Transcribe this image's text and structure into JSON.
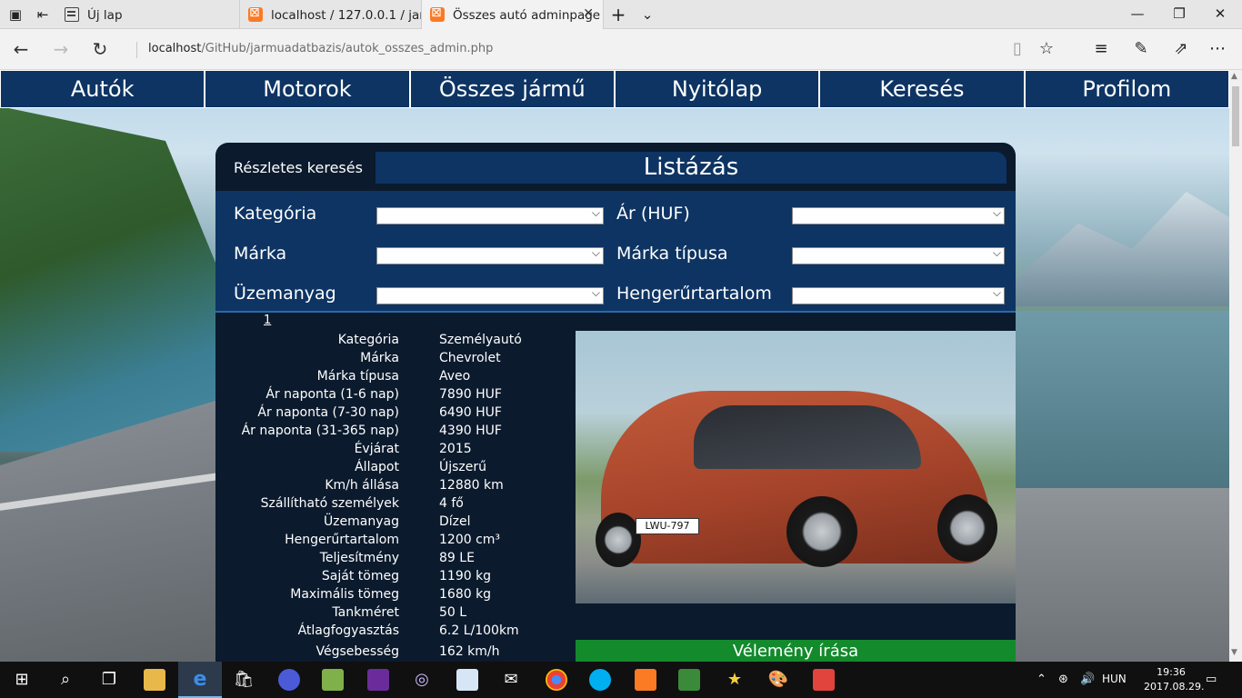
{
  "browser": {
    "tabs": [
      {
        "title": "Új lap",
        "active": false
      },
      {
        "title": "localhost / 127.0.0.1 / jarmu",
        "active": false
      },
      {
        "title": "Összes autó adminpage",
        "active": true
      }
    ],
    "new_tab_symbol": "+",
    "url_host": "localhost",
    "url_rest": "/GitHub/jarmuadatbazis/autok_osszes_admin.php"
  },
  "menu": [
    "Autók",
    "Motorok",
    "Összes jármű",
    "Nyitólap",
    "Keresés",
    "Profilom"
  ],
  "panel": {
    "search_label": "Részletes keresés",
    "list_title": "Listázás",
    "filters_left": [
      "Kategória",
      "Márka",
      "Üzemanyag"
    ],
    "filters_right": [
      "Ár (HUF)",
      "Márka típusa",
      "Hengerűrtartalom"
    ],
    "page_number": "1",
    "details": [
      {
        "label": "Kategória",
        "value": "Személyautó"
      },
      {
        "label": "Márka",
        "value": "Chevrolet"
      },
      {
        "label": "Márka típusa",
        "value": "Aveo"
      },
      {
        "label": "Ár naponta (1-6 nap)",
        "value": "7890 HUF"
      },
      {
        "label": "Ár naponta (7-30 nap)",
        "value": "6490 HUF"
      },
      {
        "label": "Ár naponta (31-365 nap)",
        "value": "4390 HUF"
      },
      {
        "label": "Évjárat",
        "value": "2015"
      },
      {
        "label": "Állapot",
        "value": "Újszerű"
      },
      {
        "label": "Km/h állása",
        "value": "12880 km"
      },
      {
        "label": "Szállítható személyek",
        "value": "4 fő"
      },
      {
        "label": "Üzemanyag",
        "value": "Dízel"
      },
      {
        "label": "Hengerűrtartalom",
        "value": "1200 cm³"
      },
      {
        "label": "Teljesítmény",
        "value": "89 LE"
      },
      {
        "label": "Saját tömeg",
        "value": "1190 kg"
      },
      {
        "label": "Maximális tömeg",
        "value": "1680 kg"
      },
      {
        "label": "Tankméret",
        "value": "50 L"
      },
      {
        "label": "Átlagfogyasztás",
        "value": "6.2 L/100km"
      },
      {
        "label": "Végsebesség",
        "value": "162 km/h"
      }
    ],
    "plate_text": "LWU-797",
    "review_button": "Vélemény írása"
  },
  "taskbar": {
    "language": "HUN",
    "time": "19:36",
    "date": "2017.08.29."
  }
}
